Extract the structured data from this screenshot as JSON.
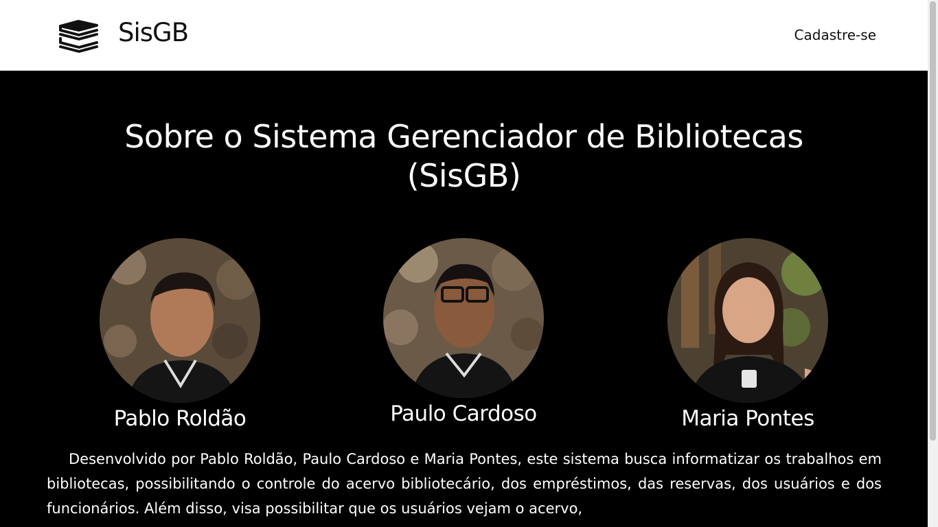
{
  "header": {
    "brand": "SisGB",
    "logo_icon": "books-stack-icon",
    "nav_link": "Cadastre-se"
  },
  "main": {
    "title": "Sobre o Sistema Gerenciador de Bibliotecas (SisGB)",
    "members": [
      {
        "name": "Pablo Roldão"
      },
      {
        "name": "Paulo Cardoso"
      },
      {
        "name": "Maria Pontes"
      }
    ],
    "description": "Desenvolvido por Pablo Roldão, Paulo Cardoso e Maria Pontes, este sistema busca informatizar os trabalhos em bibliotecas, possibilitando o controle do acervo bibliotecário, dos empréstimos, das reservas, dos usuários e dos funcionários. Além disso, visa possibilitar que os usuários vejam o acervo,"
  },
  "colors": {
    "navbar_bg": "#ffffff",
    "main_bg": "#000000",
    "text_on_dark": "#ffffff",
    "text_on_light": "#111111"
  }
}
